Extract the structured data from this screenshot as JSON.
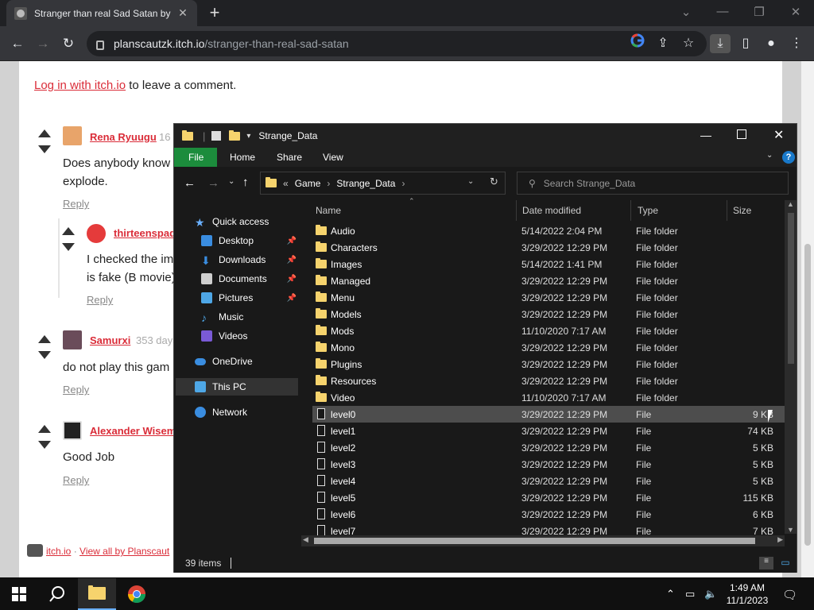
{
  "browser": {
    "tab_title": "Stranger than real Sad Satan by",
    "url_host": "planscautzk.itch.io",
    "url_path": "/stranger-than-real-sad-satan",
    "icons": [
      "back-icon",
      "forward-icon",
      "reload-icon",
      "google-icon",
      "share-icon",
      "star-icon",
      "download-icon",
      "sidepanel-icon",
      "profile-icon",
      "menu-icon"
    ]
  },
  "page": {
    "login_link": "Log in with itch.io",
    "login_suffix": "to leave a comment.",
    "comments": [
      {
        "user": "Rena Ryuugu",
        "meta": "16",
        "text1": "Does anybody know",
        "text2": "explode.",
        "reply": "Reply"
      },
      {
        "user": "thirteenspad",
        "meta": "",
        "text1": "I checked the im",
        "text2": "is fake (B movie)",
        "reply": "Reply"
      },
      {
        "user": "Samurxi",
        "meta": "353 days",
        "text1": "do not play this gam",
        "text2": "",
        "reply": "Reply"
      },
      {
        "user": "Alexander Wisem",
        "meta": "",
        "text1": "Good Job",
        "text2": "",
        "reply": "Reply"
      }
    ],
    "footer_link1": "itch.io",
    "footer_sep": "·",
    "footer_link2": "View all by Planscaut"
  },
  "explorer": {
    "title": "Strange_Data",
    "ribbon": {
      "file": "File",
      "home": "Home",
      "share": "Share",
      "view": "View"
    },
    "breadcrumb": {
      "prefix": "«",
      "part1": "Game",
      "part2": "Strange_Data"
    },
    "search_placeholder": "Search Strange_Data",
    "nav": {
      "quick_access": "Quick access",
      "desktop": "Desktop",
      "downloads": "Downloads",
      "documents": "Documents",
      "pictures": "Pictures",
      "music": "Music",
      "videos": "Videos",
      "onedrive": "OneDrive",
      "this_pc": "This PC",
      "network": "Network"
    },
    "headers": {
      "name": "Name",
      "date": "Date modified",
      "type": "Type",
      "size": "Size"
    },
    "rows": [
      {
        "name": "Audio",
        "date": "5/14/2022 2:04 PM",
        "type": "File folder",
        "size": ""
      },
      {
        "name": "Characters",
        "date": "3/29/2022 12:29 PM",
        "type": "File folder",
        "size": ""
      },
      {
        "name": "Images",
        "date": "5/14/2022 1:41 PM",
        "type": "File folder",
        "size": ""
      },
      {
        "name": "Managed",
        "date": "3/29/2022 12:29 PM",
        "type": "File folder",
        "size": ""
      },
      {
        "name": "Menu",
        "date": "3/29/2022 12:29 PM",
        "type": "File folder",
        "size": ""
      },
      {
        "name": "Models",
        "date": "3/29/2022 12:29 PM",
        "type": "File folder",
        "size": ""
      },
      {
        "name": "Mods",
        "date": "11/10/2020 7:17 AM",
        "type": "File folder",
        "size": ""
      },
      {
        "name": "Mono",
        "date": "3/29/2022 12:29 PM",
        "type": "File folder",
        "size": ""
      },
      {
        "name": "Plugins",
        "date": "3/29/2022 12:29 PM",
        "type": "File folder",
        "size": ""
      },
      {
        "name": "Resources",
        "date": "3/29/2022 12:29 PM",
        "type": "File folder",
        "size": ""
      },
      {
        "name": "Video",
        "date": "11/10/2020 7:17 AM",
        "type": "File folder",
        "size": ""
      },
      {
        "name": "level0",
        "date": "3/29/2022 12:29 PM",
        "type": "File",
        "size": "9 KB"
      },
      {
        "name": "level1",
        "date": "3/29/2022 12:29 PM",
        "type": "File",
        "size": "74 KB"
      },
      {
        "name": "level2",
        "date": "3/29/2022 12:29 PM",
        "type": "File",
        "size": "5 KB"
      },
      {
        "name": "level3",
        "date": "3/29/2022 12:29 PM",
        "type": "File",
        "size": "5 KB"
      },
      {
        "name": "level4",
        "date": "3/29/2022 12:29 PM",
        "type": "File",
        "size": "5 KB"
      },
      {
        "name": "level5",
        "date": "3/29/2022 12:29 PM",
        "type": "File",
        "size": "115 KB"
      },
      {
        "name": "level6",
        "date": "3/29/2022 12:29 PM",
        "type": "File",
        "size": "6 KB"
      },
      {
        "name": "level7",
        "date": "3/29/2022 12:29 PM",
        "type": "File",
        "size": "7 KB"
      }
    ],
    "status": "39 items"
  },
  "taskbar": {
    "time": "1:49 AM",
    "date": "11/1/2023",
    "icons": [
      "windows-start-icon",
      "search-icon",
      "file-explorer-icon",
      "chrome-icon"
    ]
  },
  "colors": {
    "accent": "#0078d4",
    "ribbon_file": "#1c8c3c",
    "link": "#da2c38",
    "folder": "#f6d36d"
  }
}
